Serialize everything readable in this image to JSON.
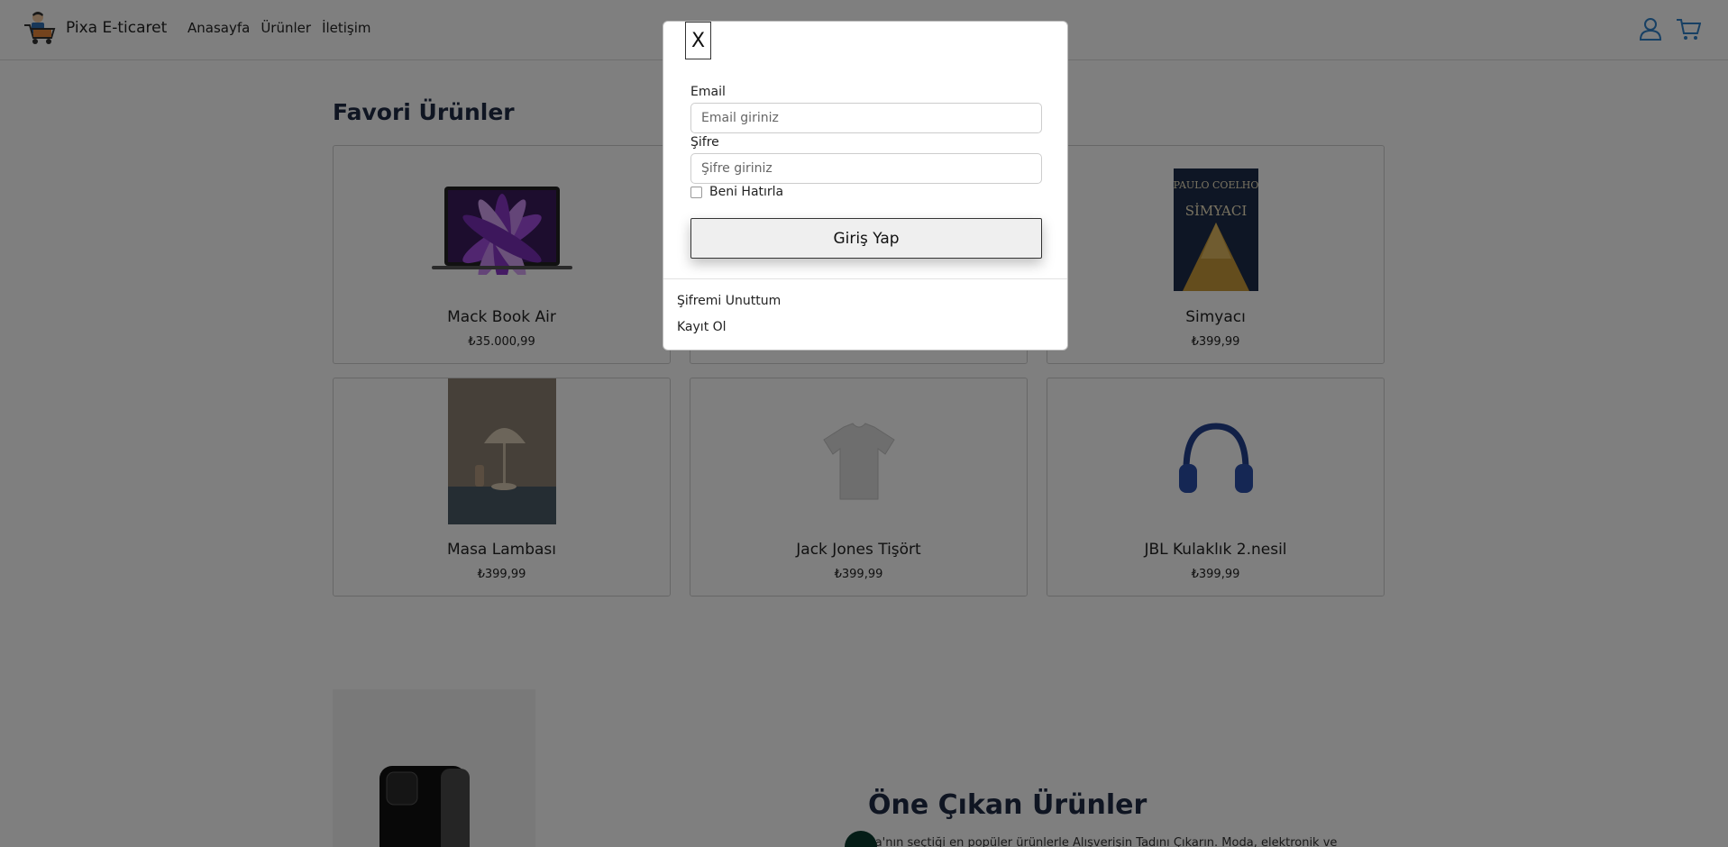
{
  "navbar": {
    "brand_name": "Pixa E-ticaret",
    "links": [
      "Anasayfa",
      "Ürünler",
      "İletişim"
    ]
  },
  "favorites": {
    "title": "Favori Ürünler",
    "products": [
      {
        "name": "Mack Book Air",
        "price": "₺35.000,99"
      },
      {
        "name": "",
        "price": ""
      },
      {
        "name": "Simyacı",
        "price": "₺399,99"
      },
      {
        "name": "Masa Lambası",
        "price": "₺399,99"
      },
      {
        "name": "Jack Jones Tişört",
        "price": "₺399,99"
      },
      {
        "name": "JBL Kulaklık 2.nesil",
        "price": "₺399,99"
      }
    ]
  },
  "featured": {
    "title": "Öne Çıkan Ürünler",
    "description": "xa'nın seçtiği en popüler ürünlerle Alışverişin Tadını Çıkarın. Moda, elektronik ve"
  },
  "book_cover": {
    "author": "PAULO COELHO",
    "title": "SİMYACI"
  },
  "login_modal": {
    "close_label": "X",
    "email_label": "Email",
    "email_placeholder": "Email giriniz",
    "password_label": "Şifre",
    "password_placeholder": "Şifre giriniz",
    "remember_label": "Beni Hatırla",
    "login_button": "Giriş Yap",
    "forgot_password": "Şifremi Unuttum",
    "register": "Kayıt Ol"
  },
  "colors": {
    "overlay": "rgba(0,0,0,0.5)",
    "title_navy": "#1f2a44",
    "icon_blue": "#2f80c9"
  }
}
